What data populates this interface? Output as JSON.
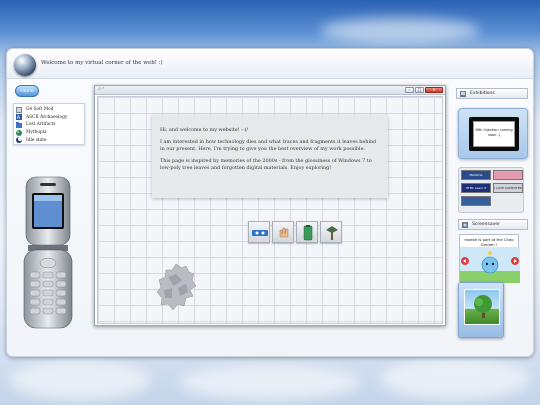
{
  "header": {
    "welcome": "Welcome to my virtual corner of the web! :)"
  },
  "sidebar": {
    "home_label": "Home",
    "items": [
      {
        "label": "G4 Soft Mod",
        "icon": "wrench-icon"
      },
      {
        "label": "ASCII Archaeology",
        "icon": "ascii-icon"
      },
      {
        "label": "Lost Artifacts",
        "icon": "folder-icon"
      },
      {
        "label": "Mythopia",
        "icon": "globe-icon"
      },
      {
        "label": "Idle state",
        "icon": "moon-icon"
      }
    ]
  },
  "window": {
    "title": "♪◦°",
    "minimize": "–",
    "maximize": "□",
    "close": "×",
    "paragraphs": [
      "Hi, and welcome to my website! :-)/",
      "I am interested in how technology dies and what traces and fragments it leaves behind in our present. Here, I'm trying to give you the best overview of my work possible.",
      "This page is inspired by memories of the 2000s - from the glossiness of Windows 7 to low-poly tree leaves and forgotten digital materials. Enjoy exploring!"
    ]
  },
  "right": {
    "exhibitions_label": "Exhibitions",
    "exhibit_note": "Milk Injection coming soon :)",
    "screensaver_label": "Screensaver",
    "chao_text": "moeke is part of the Chao Garden !"
  },
  "badges": [
    {
      "label": "MASUDA ROMANTIC",
      "color": "#2b4a8c"
    },
    {
      "label": "",
      "color": "#e59ab0"
    },
    {
      "label": "HTML Learn It Today",
      "color": "#1d2f77"
    },
    {
      "label": "I LOVE COMPUTER",
      "color": "#cfd3d9"
    },
    {
      "label": "",
      "color": "#355f9a"
    }
  ],
  "colors": {
    "accent": "#4f95d8",
    "close": "#d2463a"
  }
}
